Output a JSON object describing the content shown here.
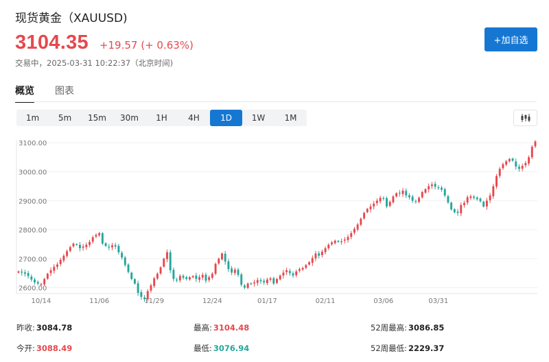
{
  "header": {
    "title": "现货黄金（XAUUSD)",
    "price": "3104.35",
    "change": "+19.57 (+ 0.63%)",
    "status": "交易中，2025-03-31 10:22:37（北京时间)",
    "add_button": "+加自选"
  },
  "tabs": [
    {
      "label": "概览",
      "active": true
    },
    {
      "label": "图表",
      "active": false
    }
  ],
  "periods": [
    {
      "label": "1m",
      "active": false
    },
    {
      "label": "5m",
      "active": false
    },
    {
      "label": "15m",
      "active": false
    },
    {
      "label": "30m",
      "active": false
    },
    {
      "label": "1H",
      "active": false
    },
    {
      "label": "4H",
      "active": false
    },
    {
      "label": "1D",
      "active": true
    },
    {
      "label": "1W",
      "active": false
    },
    {
      "label": "1M",
      "active": false
    }
  ],
  "colors": {
    "up": "#e5484d",
    "down": "#26a69a",
    "accent": "#1677d2"
  },
  "icons": {
    "chart_type": "candlestick-icon"
  },
  "chart_data": {
    "type": "candlestick",
    "ylim": [
      2580,
      3110
    ],
    "y_ticks": [
      2600,
      2700,
      2800,
      2900,
      3000,
      3100
    ],
    "y_tick_labels": [
      "2600.00",
      "2700.00",
      "2800.00",
      "2900.00",
      "3000.00",
      "3100.00"
    ],
    "x_tick_labels": [
      {
        "label": "10/14",
        "index": 7
      },
      {
        "label": "11/06",
        "index": 25
      },
      {
        "label": "11/29",
        "index": 42
      },
      {
        "label": "12/24",
        "index": 60
      },
      {
        "label": "01/17",
        "index": 77
      },
      {
        "label": "02/11",
        "index": 95
      },
      {
        "label": "03/06",
        "index": 113
      },
      {
        "label": "03/31",
        "index": 130
      }
    ],
    "grid": true,
    "closes": [
      2656,
      2652,
      2648,
      2640,
      2628,
      2618,
      2614,
      2612,
      2630,
      2648,
      2660,
      2672,
      2680,
      2696,
      2710,
      2726,
      2740,
      2752,
      2748,
      2736,
      2742,
      2748,
      2758,
      2774,
      2782,
      2788,
      2752,
      2744,
      2740,
      2746,
      2742,
      2722,
      2704,
      2678,
      2654,
      2630,
      2614,
      2582,
      2568,
      2560,
      2588,
      2608,
      2632,
      2648,
      2670,
      2700,
      2722,
      2660,
      2630,
      2626,
      2640,
      2634,
      2630,
      2636,
      2640,
      2630,
      2636,
      2644,
      2624,
      2636,
      2648,
      2682,
      2700,
      2718,
      2690,
      2664,
      2652,
      2662,
      2644,
      2610,
      2600,
      2614,
      2612,
      2618,
      2626,
      2622,
      2618,
      2628,
      2632,
      2614,
      2630,
      2642,
      2652,
      2660,
      2650,
      2642,
      2656,
      2664,
      2668,
      2678,
      2688,
      2702,
      2718,
      2710,
      2724,
      2736,
      2748,
      2756,
      2762,
      2758,
      2760,
      2766,
      2775,
      2788,
      2803,
      2818,
      2838,
      2858,
      2872,
      2880,
      2890,
      2900,
      2910,
      2908,
      2880,
      2896,
      2915,
      2926,
      2925,
      2935,
      2918,
      2912,
      2900,
      2896,
      2910,
      2930,
      2940,
      2950,
      2956,
      2948,
      2945,
      2938,
      2918,
      2894,
      2870,
      2860,
      2858,
      2885,
      2892,
      2912,
      2915,
      2910,
      2905,
      2898,
      2880,
      2900,
      2918,
      2950,
      2985,
      3010,
      3026,
      3036,
      3044,
      3038,
      3018,
      3010,
      3020,
      3030,
      3050,
      3086,
      3104.35
    ],
    "prev_close": "3084.78",
    "open": "3088.49",
    "high": "3104.48",
    "low": "3076.94",
    "high_52w": "3086.85",
    "low_52w": "2229.37"
  },
  "stats_labels": {
    "prev_close": "昨收:",
    "open": "今开:",
    "high": "最高:",
    "low": "最低:",
    "high_52w": "52周最高:",
    "low_52w": "52周最低:"
  }
}
